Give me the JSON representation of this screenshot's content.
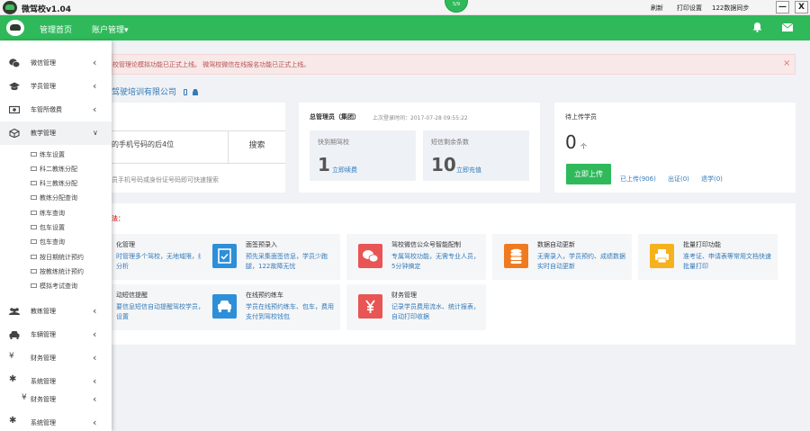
{
  "titlebar": {
    "app_title": "微驾校v1.04",
    "badge": "5/9",
    "links": [
      "刷新",
      "打印设置",
      "122数据同步"
    ],
    "minimize": "—",
    "close": "X"
  },
  "nav": {
    "home": "管理首页",
    "account": "账户管理▾"
  },
  "sidebar": {
    "items": [
      {
        "label": "微信管理",
        "icon": "wechat-icon"
      },
      {
        "label": "学员管理",
        "icon": "graduation-cap-icon"
      },
      {
        "label": "车管所缴费",
        "icon": "money-icon"
      },
      {
        "label": "教学管理",
        "icon": "cube-icon"
      },
      {
        "label": "教练管理",
        "icon": "users-icon"
      },
      {
        "label": "车辆管理",
        "icon": "car-icon"
      },
      {
        "label": "财务管理",
        "icon": "yen-icon"
      },
      {
        "label": "系统管理",
        "icon": "gear-icon"
      },
      {
        "label": "财务管理",
        "icon": "yen-icon"
      },
      {
        "label": "系统管理",
        "icon": "gear-icon"
      }
    ],
    "sub_items": [
      "练车设置",
      "科二教练分配",
      "科三教练分配",
      "教练分配查询",
      "练车查询",
      "包车设置",
      "包车查询",
      "按日期统计预约",
      "按教练统计预约",
      "模拟考试查询"
    ]
  },
  "alert": {
    "text": "校管理论模拟功能已正式上线。     微驾校微信在线报名功能已正式上线。",
    "close": "×"
  },
  "company": "驾驶培训有限公司",
  "search": {
    "input_text": "的手机号码的后4位",
    "button": "搜索",
    "tip": "员手机号码或身份证号码即可快速搜索"
  },
  "admin": {
    "title": "总管理员（集团）",
    "last_login": "上次登录时间：2017-07-28 09:55:22",
    "expire_label": "快到期驾校",
    "expire_count": "1",
    "expire_link": "立即续费",
    "sms_label": "短信剩余条数",
    "sms_count": "10",
    "sms_link": "立即充值"
  },
  "upload": {
    "title": "待上传学员",
    "count": "0",
    "unit": "个",
    "button": "立即上传",
    "uploaded": "已上传(906)",
    "certified": "出证(0)",
    "withdrawn": "退学(0)"
  },
  "features": {
    "heading": "法：",
    "tiles": [
      {
        "title": "化管理",
        "desc": "时管理多个驾校，无地域限，综合统计分析",
        "icon": "",
        "color": ""
      },
      {
        "title": "面签预录入",
        "desc": "预先采集面签信息，学员少跑腿，122故障无忧",
        "icon": "checklist-icon",
        "color": "#2d8fd8"
      },
      {
        "title": "驾校微信公众号智能配制",
        "desc": "专属驾校功能，无需专业人员，5分钟搞定",
        "icon": "wechat-icon",
        "color": "#e85555"
      },
      {
        "title": "数据自动更新",
        "desc": "无需录入，学员预约、成绩数据实时自动更新",
        "icon": "database-icon",
        "color": "#f07a1f"
      },
      {
        "title": "批量打印功能",
        "desc": "准考证、申请表等常用文档快速批量打印",
        "icon": "printer-icon",
        "color": "#f5b21d"
      },
      {
        "title": "动短信提醒",
        "desc": "要信息短信自动提醒驾校学员，驾校可设置",
        "icon": "",
        "color": ""
      },
      {
        "title": "在线预约练车",
        "desc": "学员在线预约练车、包车，费用支付到驾校钱包",
        "icon": "car-icon",
        "color": "#2d8fd8"
      },
      {
        "title": "财务管理",
        "desc": "记录学员费用流水、统计报表，自动打印收据",
        "icon": "yen-icon",
        "color": "#e85555"
      }
    ]
  },
  "colors": {
    "brand": "#2fb95b",
    "link": "#337ab7",
    "alert": "#b45252"
  }
}
